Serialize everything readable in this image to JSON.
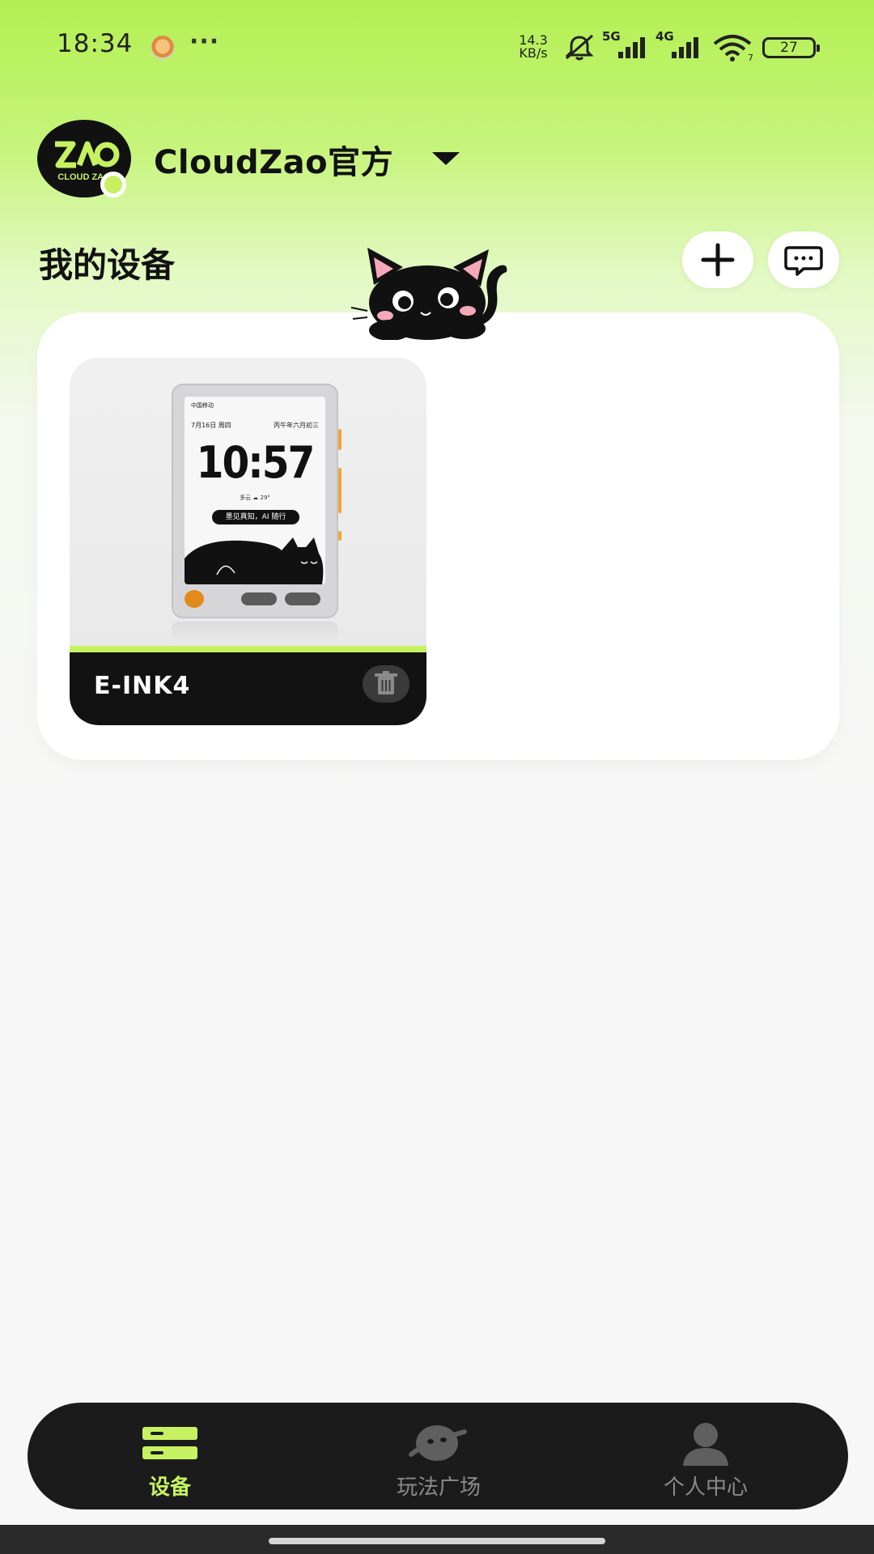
{
  "status_bar": {
    "time": "18:34",
    "more": "···",
    "speed_value": "14.3",
    "speed_unit": "KB/s",
    "net1": "5G",
    "net2": "4G",
    "wifi_sub": "7",
    "battery": "27"
  },
  "account": {
    "name": "CloudZao官方",
    "logo_text": "CLOUD ZAO"
  },
  "section": {
    "title": "我的设备"
  },
  "device": {
    "name": "E-INK4",
    "screen": {
      "status_left": "中国移动",
      "date": "7月16日 周四",
      "lunar": "丙午年六月初三",
      "time": "10:57",
      "weather": "多云 ☁ 29°",
      "bubble": "墨见真知，AI 随行"
    }
  },
  "bottom_nav": {
    "items": [
      {
        "label": "设备",
        "icon": "devices-icon",
        "active": true
      },
      {
        "label": "玩法广场",
        "icon": "planet-icon",
        "active": false
      },
      {
        "label": "个人中心",
        "icon": "user-icon",
        "active": false
      }
    ]
  },
  "colors": {
    "accent": "#c6f261",
    "header_green": "#b3f053",
    "nav_background": "#1b1b1b"
  }
}
